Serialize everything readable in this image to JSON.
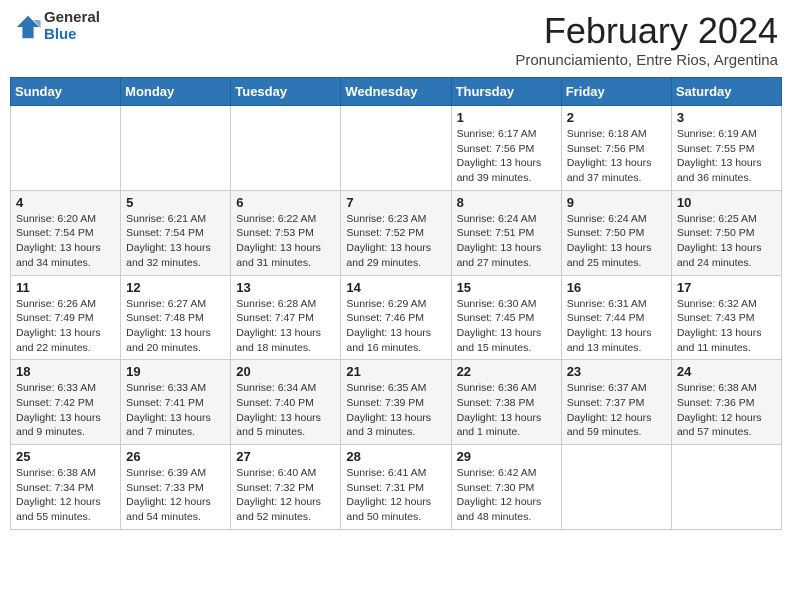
{
  "header": {
    "logo_general": "General",
    "logo_blue": "Blue",
    "main_title": "February 2024",
    "subtitle": "Pronunciamiento, Entre Rios, Argentina"
  },
  "calendar": {
    "days_of_week": [
      "Sunday",
      "Monday",
      "Tuesday",
      "Wednesday",
      "Thursday",
      "Friday",
      "Saturday"
    ],
    "weeks": [
      [
        {
          "day": "",
          "info": ""
        },
        {
          "day": "",
          "info": ""
        },
        {
          "day": "",
          "info": ""
        },
        {
          "day": "",
          "info": ""
        },
        {
          "day": "1",
          "info": "Sunrise: 6:17 AM\nSunset: 7:56 PM\nDaylight: 13 hours and 39 minutes."
        },
        {
          "day": "2",
          "info": "Sunrise: 6:18 AM\nSunset: 7:56 PM\nDaylight: 13 hours and 37 minutes."
        },
        {
          "day": "3",
          "info": "Sunrise: 6:19 AM\nSunset: 7:55 PM\nDaylight: 13 hours and 36 minutes."
        }
      ],
      [
        {
          "day": "4",
          "info": "Sunrise: 6:20 AM\nSunset: 7:54 PM\nDaylight: 13 hours and 34 minutes."
        },
        {
          "day": "5",
          "info": "Sunrise: 6:21 AM\nSunset: 7:54 PM\nDaylight: 13 hours and 32 minutes."
        },
        {
          "day": "6",
          "info": "Sunrise: 6:22 AM\nSunset: 7:53 PM\nDaylight: 13 hours and 31 minutes."
        },
        {
          "day": "7",
          "info": "Sunrise: 6:23 AM\nSunset: 7:52 PM\nDaylight: 13 hours and 29 minutes."
        },
        {
          "day": "8",
          "info": "Sunrise: 6:24 AM\nSunset: 7:51 PM\nDaylight: 13 hours and 27 minutes."
        },
        {
          "day": "9",
          "info": "Sunrise: 6:24 AM\nSunset: 7:50 PM\nDaylight: 13 hours and 25 minutes."
        },
        {
          "day": "10",
          "info": "Sunrise: 6:25 AM\nSunset: 7:50 PM\nDaylight: 13 hours and 24 minutes."
        }
      ],
      [
        {
          "day": "11",
          "info": "Sunrise: 6:26 AM\nSunset: 7:49 PM\nDaylight: 13 hours and 22 minutes."
        },
        {
          "day": "12",
          "info": "Sunrise: 6:27 AM\nSunset: 7:48 PM\nDaylight: 13 hours and 20 minutes."
        },
        {
          "day": "13",
          "info": "Sunrise: 6:28 AM\nSunset: 7:47 PM\nDaylight: 13 hours and 18 minutes."
        },
        {
          "day": "14",
          "info": "Sunrise: 6:29 AM\nSunset: 7:46 PM\nDaylight: 13 hours and 16 minutes."
        },
        {
          "day": "15",
          "info": "Sunrise: 6:30 AM\nSunset: 7:45 PM\nDaylight: 13 hours and 15 minutes."
        },
        {
          "day": "16",
          "info": "Sunrise: 6:31 AM\nSunset: 7:44 PM\nDaylight: 13 hours and 13 minutes."
        },
        {
          "day": "17",
          "info": "Sunrise: 6:32 AM\nSunset: 7:43 PM\nDaylight: 13 hours and 11 minutes."
        }
      ],
      [
        {
          "day": "18",
          "info": "Sunrise: 6:33 AM\nSunset: 7:42 PM\nDaylight: 13 hours and 9 minutes."
        },
        {
          "day": "19",
          "info": "Sunrise: 6:33 AM\nSunset: 7:41 PM\nDaylight: 13 hours and 7 minutes."
        },
        {
          "day": "20",
          "info": "Sunrise: 6:34 AM\nSunset: 7:40 PM\nDaylight: 13 hours and 5 minutes."
        },
        {
          "day": "21",
          "info": "Sunrise: 6:35 AM\nSunset: 7:39 PM\nDaylight: 13 hours and 3 minutes."
        },
        {
          "day": "22",
          "info": "Sunrise: 6:36 AM\nSunset: 7:38 PM\nDaylight: 13 hours and 1 minute."
        },
        {
          "day": "23",
          "info": "Sunrise: 6:37 AM\nSunset: 7:37 PM\nDaylight: 12 hours and 59 minutes."
        },
        {
          "day": "24",
          "info": "Sunrise: 6:38 AM\nSunset: 7:36 PM\nDaylight: 12 hours and 57 minutes."
        }
      ],
      [
        {
          "day": "25",
          "info": "Sunrise: 6:38 AM\nSunset: 7:34 PM\nDaylight: 12 hours and 55 minutes."
        },
        {
          "day": "26",
          "info": "Sunrise: 6:39 AM\nSunset: 7:33 PM\nDaylight: 12 hours and 54 minutes."
        },
        {
          "day": "27",
          "info": "Sunrise: 6:40 AM\nSunset: 7:32 PM\nDaylight: 12 hours and 52 minutes."
        },
        {
          "day": "28",
          "info": "Sunrise: 6:41 AM\nSunset: 7:31 PM\nDaylight: 12 hours and 50 minutes."
        },
        {
          "day": "29",
          "info": "Sunrise: 6:42 AM\nSunset: 7:30 PM\nDaylight: 12 hours and 48 minutes."
        },
        {
          "day": "",
          "info": ""
        },
        {
          "day": "",
          "info": ""
        }
      ]
    ]
  }
}
